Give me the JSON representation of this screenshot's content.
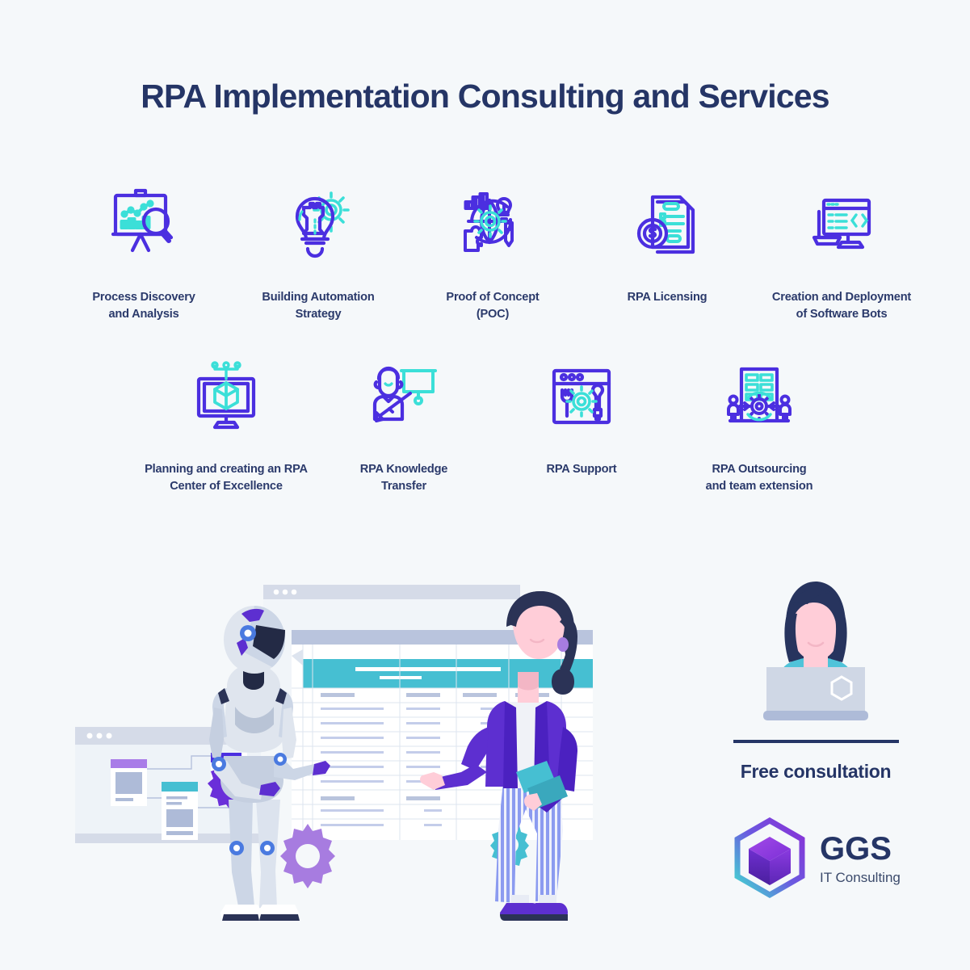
{
  "header": {
    "title": "RPA Implementation Consulting and Services"
  },
  "services": {
    "row1": [
      {
        "label": "Process Discovery\nand Analysis",
        "icon": "presentation-chart-magnifier-icon"
      },
      {
        "label": "Building Automation\nStrategy",
        "icon": "lightbulb-chess-rook-gear-icon"
      },
      {
        "label": "Proof of Concept\n(POC)",
        "icon": "globe-gear-concept-icon"
      },
      {
        "label": "RPA Licensing",
        "icon": "document-dollar-coin-icon"
      },
      {
        "label": "Creation and Deployment\nof Software Bots",
        "icon": "monitor-code-brackets-icon"
      }
    ],
    "row2": [
      {
        "label": "Planning and creating an RPA\nCenter of Excellence",
        "icon": "monitor-cube-network-icon"
      },
      {
        "label": "RPA Knowledge\nTransfer",
        "icon": "presenter-whiteboard-icon"
      },
      {
        "label": "RPA Support",
        "icon": "browser-wrench-gear-screwdriver-icon"
      },
      {
        "label": "RPA Outsourcing\nand team extension",
        "icon": "team-building-gear-arrows-icon"
      }
    ]
  },
  "consultation": {
    "heading": "Free consultation",
    "avatar_icon": "woman-at-laptop-icon"
  },
  "brand": {
    "name": "GGS",
    "tagline": "IT Consulting",
    "logo_icon": "hexagon-cube-logo-icon"
  },
  "illustration": {
    "name": "robot-and-woman-with-spreadsheet-illustration",
    "elements": [
      "browser-window-flowchart",
      "browser-window-plain",
      "spreadsheet-table-window",
      "humanoid-robot",
      "businesswoman-with-folders",
      "purple-gear",
      "lavender-gear",
      "teal-gear"
    ]
  },
  "colors": {
    "background": "#f5f8fa",
    "title_navy": "#253566",
    "label_navy": "#2b3a6b",
    "icon_violet": "#4b2fe0",
    "icon_cyan": "#3bdfd8",
    "accent_teal": "#46bfd2",
    "accent_purple": "#6a2fd9",
    "accent_lavender": "#a77ce0",
    "logo_gradient_start": "#3fe0d0",
    "logo_gradient_end": "#8b2fd6"
  }
}
